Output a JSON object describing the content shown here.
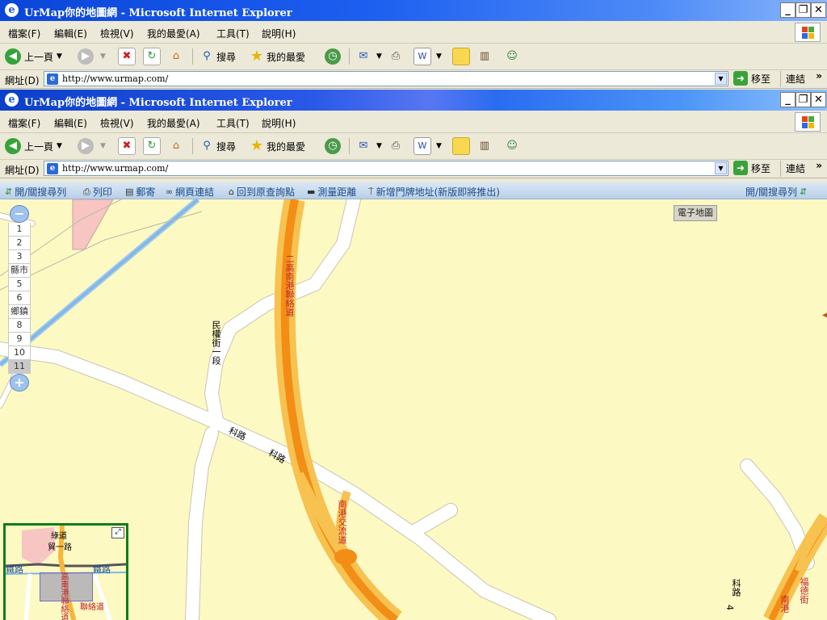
{
  "window": {
    "title": "UrMap你的地圖網 - Microsoft Internet Explorer",
    "buttons": [
      "_",
      "❐",
      "✕"
    ]
  },
  "menu": [
    "檔案(F)",
    "編輯(E)",
    "檢視(V)",
    "我的最愛(A)",
    "工具(T)",
    "說明(H)"
  ],
  "toolbar": {
    "back": "上一頁",
    "search": "搜尋",
    "favorites": "我的最愛"
  },
  "address": {
    "label": "網址(D)",
    "url": "http://www.urmap.com/",
    "go": "移至",
    "links": "連結"
  },
  "maptools": {
    "toggle_search": "開/關搜尋列",
    "print": "列印",
    "mail": "郵寄",
    "link": "網頁連結",
    "home": "回到原查詢點",
    "measure": "測量距離",
    "add_address": "新增門牌地址(新版即將推出)",
    "toggle_search_right": "開/關搜尋列"
  },
  "map": {
    "type_label": "電子地圖",
    "zoom_levels": [
      "1",
      "2",
      "3",
      "縣市",
      "5",
      "6",
      "鄉鎮",
      "8",
      "9",
      "10",
      "11"
    ],
    "active_zoom": "11",
    "labels": {
      "expressway": "二高南港聯絡道",
      "interchange": "南港交流道",
      "minquan": "民權街一段",
      "keji1": "科路",
      "keji2": "科路",
      "keji3": "科路",
      "fujia": "福德街",
      "right_red": "南港",
      "small4": "4"
    }
  },
  "overview": {
    "labels": [
      "綠道",
      "貿一路",
      "鐵路",
      "鐵路",
      "高南港聯絡道",
      "聯絡道"
    ]
  },
  "colors": {
    "expressway": "#f7b53a",
    "expressway_core": "#f28d16",
    "map_bg": "#fdf9c3",
    "road": "#ffffff",
    "river": "#7fb6e6"
  }
}
